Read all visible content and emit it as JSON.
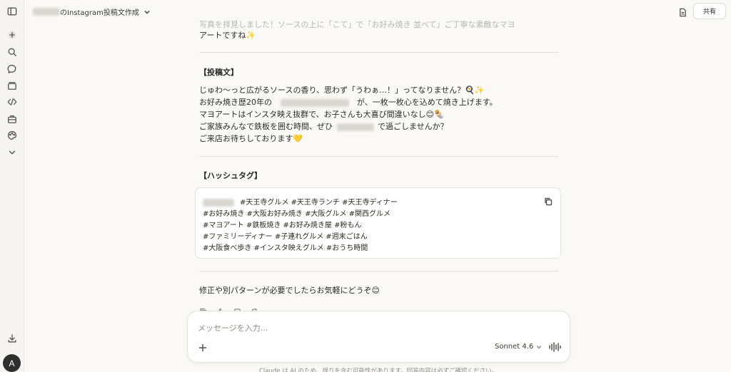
{
  "topbar": {
    "title_suffix": "のInstagram投稿文作成",
    "share_label": "共有"
  },
  "sidebar": {
    "icons": [
      "sidebar-toggle-icon",
      "new-chat-icon",
      "search-icon",
      "chats-icon",
      "projects-icon",
      "code-icon",
      "artifacts-icon",
      "palette-icon",
      "chevron-down-icon",
      "download-icon"
    ],
    "avatar_letter": "A"
  },
  "message": {
    "faded_line": "写真を拝見しました！ソースの上に「こて」で「お好み焼き 並べて」ご丁寧な素敵なマヨ",
    "intro_end": "アートですね✨",
    "post_heading": "【投稿文】",
    "post_lines": [
      "じゅわ〜っと広がるソースの香り、思わず「うわぁ…！」ってなりません？🍳✨",
      "お好み焼き歴20年の",
      "が、一枚一枚心を込めて焼き上げます。",
      "マヨアートはインスタ映え抜群で、お子さんも大喜び間違いなし😊🌯",
      "ご家族みんなで鉄板を囲む時間、ぜひ",
      "で過ごしませんか？",
      "ご来店お待ちしております💛"
    ],
    "hashtag_heading": "【ハッシュタグ】",
    "hashtag_lines": [
      "#天王寺グルメ  #天王寺ランチ  #天王寺ディナー",
      "#お好み焼き  #大阪お好み焼き  #大阪グルメ  #関西グルメ",
      "#マヨアート  #鉄板焼き  #お好み焼き屋  #粉もん",
      "#ファミリーディナー  #子連れグルメ  #週末ごはん",
      "#大阪食べ歩き  #インスタ映えグルメ  #おうち時間"
    ],
    "closing": "修正や別パターンが必要でしたらお気軽にどうぞ😊"
  },
  "composer": {
    "placeholder": "メッセージを入力...",
    "model": "Sonnet 4.6"
  },
  "disclaimer": "Claude は AI のため、誤りを含む可能性があります。回答内容は必ずご確認ください。"
}
